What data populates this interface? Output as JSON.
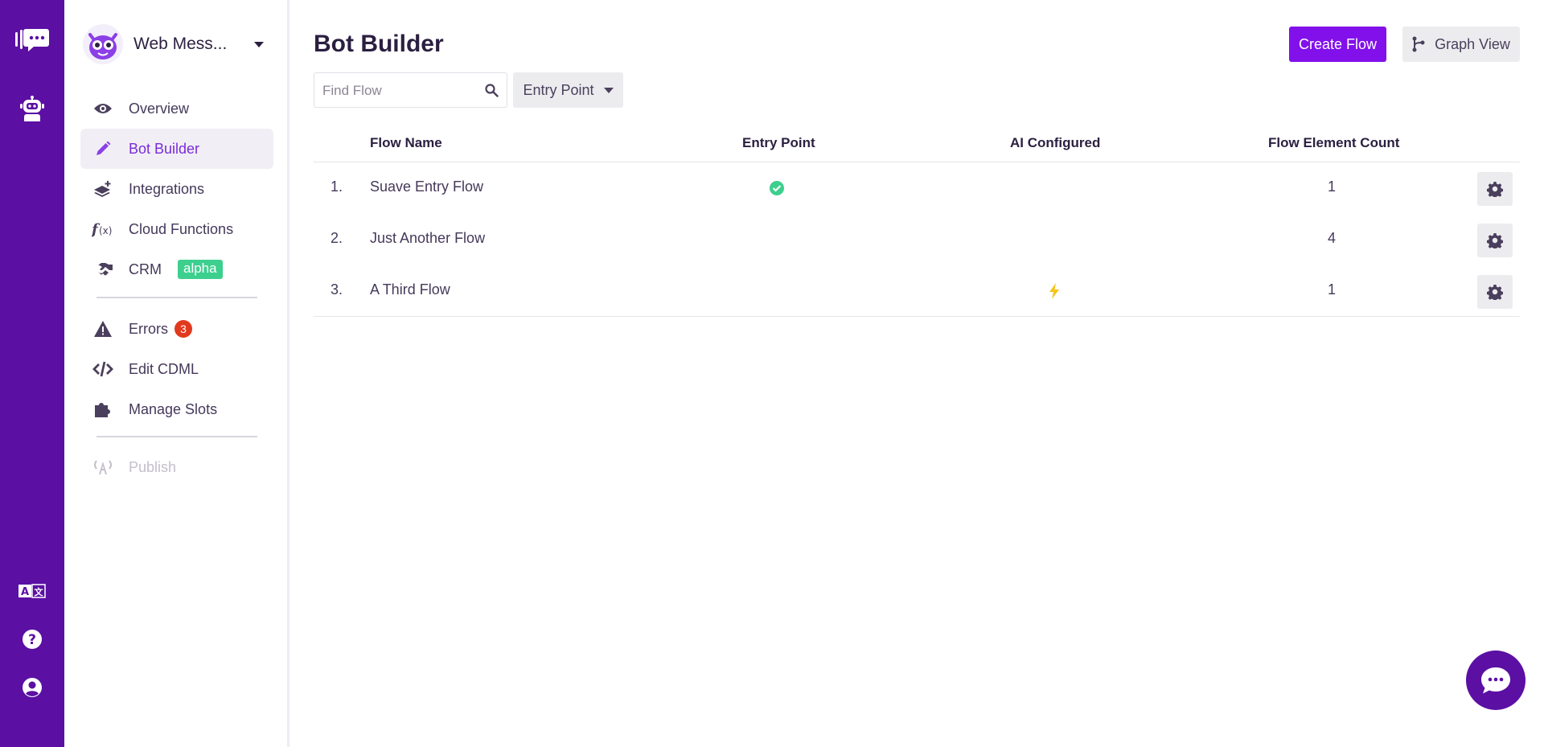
{
  "sidebar": {
    "bot_name": "Web Mess...",
    "items": [
      {
        "label": "Overview",
        "icon": "eye-icon"
      },
      {
        "label": "Bot Builder",
        "icon": "pencil-icon",
        "active": true
      },
      {
        "label": "Integrations",
        "icon": "layers-plus-icon"
      },
      {
        "label": "Cloud Functions",
        "icon": "function-icon"
      },
      {
        "label": "CRM",
        "icon": "handshake-icon",
        "badge": "alpha"
      },
      {
        "label": "Errors",
        "icon": "warning-icon",
        "badge": "3"
      },
      {
        "label": "Edit CDML",
        "icon": "code-icon"
      },
      {
        "label": "Manage Slots",
        "icon": "puzzle-icon"
      },
      {
        "label": "Publish",
        "icon": "broadcast-icon",
        "disabled": true
      }
    ]
  },
  "header": {
    "title": "Bot Builder",
    "create_label": "Create Flow",
    "graph_label": "Graph View"
  },
  "filters": {
    "search_placeholder": "Find Flow",
    "search_value": "",
    "dropdown_label": "Entry Point"
  },
  "table": {
    "columns": [
      "Flow Name",
      "Entry Point",
      "AI Configured",
      "Flow Element Count"
    ],
    "rows": [
      {
        "index": "1.",
        "name": "Suave Entry Flow",
        "entry_point": true,
        "ai_configured": false,
        "count": "1"
      },
      {
        "index": "2.",
        "name": "Just Another Flow",
        "entry_point": false,
        "ai_configured": false,
        "count": "4"
      },
      {
        "index": "3.",
        "name": "A Third Flow",
        "entry_point": false,
        "ai_configured": true,
        "count": "1"
      }
    ]
  },
  "colors": {
    "rail": "#5b0fa3",
    "primary": "#8210ea",
    "active_text": "#7b2bd9",
    "success": "#3ccf8e",
    "error": "#e2391e",
    "bolt": "#f5c518"
  }
}
